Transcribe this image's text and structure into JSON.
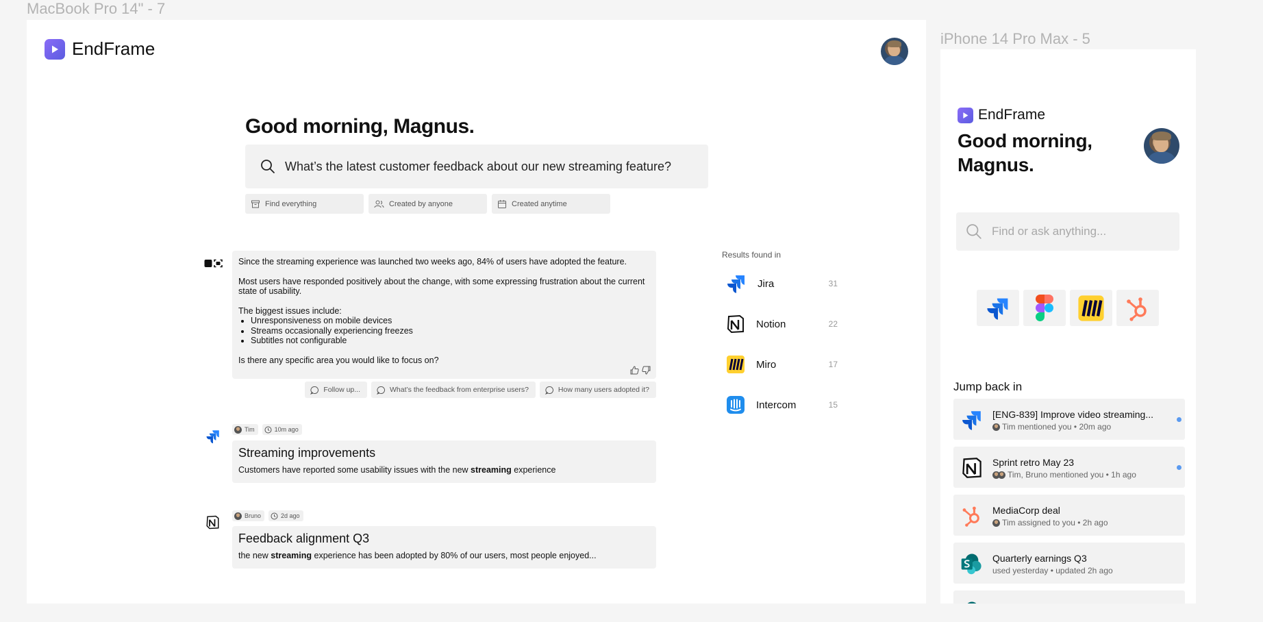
{
  "frames": {
    "desktop_label": "MacBook Pro 14\" - 7",
    "mobile_label": "iPhone 14 Pro Max - 5"
  },
  "brand": {
    "name": "EndFrame",
    "accent": "#6b5ce7"
  },
  "desktop": {
    "greeting": "Good morning, Magnus.",
    "search_query": "What’s the latest customer feedback about our new streaming feature?",
    "filters": [
      {
        "label": "Find everything",
        "icon": "archive-icon"
      },
      {
        "label": "Created by anyone",
        "icon": "users-icon"
      },
      {
        "label": "Created anytime",
        "icon": "calendar-icon"
      }
    ],
    "answer": {
      "p1": "Since the streaming experience was launched two weeks ago, 84% of users have adopted the feature.",
      "p2": "Most users have responded positively about the change, with some expressing frustration about the current state of usability.",
      "p3": "The biggest issues include:",
      "issues": [
        "Unresponsiveness on mobile devices",
        "Streams occasionally experiencing freezes",
        "Subtitles not configurable"
      ],
      "p4": "Is there any specific area you would like to focus on?"
    },
    "suggestions": [
      "Follow up...",
      "What’s the feedback from enterprise users?",
      "How many users adopted it?"
    ],
    "results": {
      "title": "Results found in",
      "sources": [
        {
          "name": "Jira",
          "count": "31"
        },
        {
          "name": "Notion",
          "count": "22"
        },
        {
          "name": "Miro",
          "count": "17"
        },
        {
          "name": "Intercom",
          "count": "15"
        }
      ]
    },
    "docs": [
      {
        "author": "Tim",
        "time": "10m ago",
        "title": "Streaming improvements",
        "snippet_pre": "Customers have reported some usability issues with the new ",
        "snippet_bold": "streaming",
        "snippet_post": " experience"
      },
      {
        "author": "Bruno",
        "time": "2d ago",
        "title": "Feedback alignment Q3",
        "snippet_pre": "the new ",
        "snippet_bold": "streaming",
        "snippet_post": " experience has been adopted by 80% of our users, most people enjoyed..."
      }
    ]
  },
  "mobile": {
    "greeting_line1": "Good morning,",
    "greeting_line2": "Magnus.",
    "search_placeholder": "Find or ask anything...",
    "jump_title": "Jump back in",
    "jump_items": [
      {
        "title": "[ENG-839] Improve video streaming...",
        "sub": "Tim mentioned you • 20m ago"
      },
      {
        "title": "Sprint retro May 23",
        "sub": "Tim, Bruno mentioned you  • 1h ago"
      },
      {
        "title": "MediaCorp deal",
        "sub": "Tim assigned to you • 2h ago"
      },
      {
        "title": "Quarterly earnings Q3",
        "sub": "used yesterday • updated 2h ago"
      }
    ]
  }
}
